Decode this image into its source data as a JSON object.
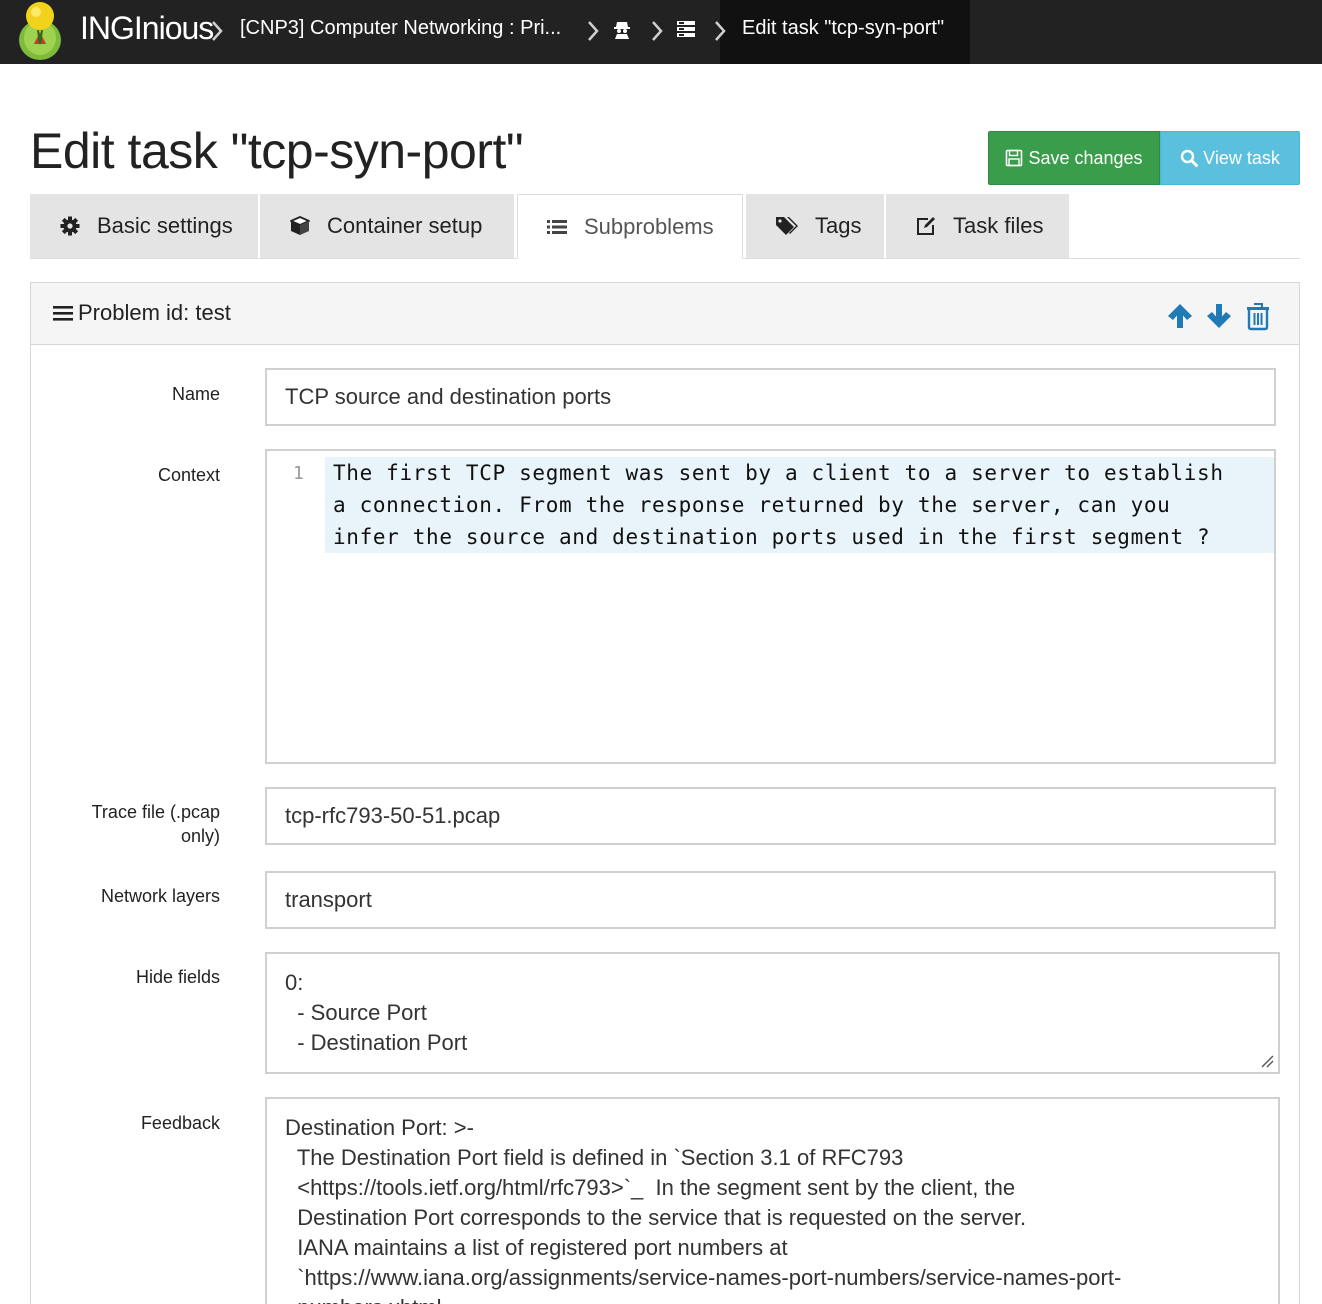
{
  "navbar": {
    "brand": "INGInious",
    "course": "[CNP3] Computer Networking : Pri...",
    "course_admin_icon": "user-secret-icon",
    "tasks_icon": "tasks-list-icon",
    "current": "Edit task \"tcp-syn-port\""
  },
  "header": {
    "title": "Edit task \"tcp-syn-port\"",
    "save_label": "Save changes",
    "view_label": "View task",
    "save_color": "#3a9d4b",
    "view_color": "#5bc0de"
  },
  "tabs": [
    {
      "label": "Basic settings",
      "icon": "gear-icon"
    },
    {
      "label": "Container setup",
      "icon": "cube-icon"
    },
    {
      "label": "Subproblems",
      "icon": "list-icon",
      "active": true
    },
    {
      "label": "Tags",
      "icon": "tags-icon"
    },
    {
      "label": "Task files",
      "icon": "edit-icon"
    }
  ],
  "problem": {
    "title": "Problem id: test",
    "name_label": "Name",
    "name_value": "TCP source and destination ports",
    "context_label": "Context",
    "context_line_number": "1",
    "context_lines": [
      "The first TCP segment was sent by a client to a server to establish",
      "a connection. From the response returned by the server, can you",
      "infer the source and destination ports used in the first segment ?"
    ],
    "trace_label_1": "Trace file (.pcap",
    "trace_label_2": "only)",
    "trace_value": "tcp-rfc793-50-51.pcap",
    "layers_label": "Network layers",
    "layers_value": "transport",
    "hide_label": "Hide fields",
    "hide_lines": [
      "0:",
      "  - Source Port",
      "  - Destination Port"
    ],
    "feedback_label": "Feedback",
    "feedback_lines": [
      "Destination Port: >-",
      "  The Destination Port field is defined in `Section 3.1 of RFC793",
      "  <https://tools.ietf.org/html/rfc793>`_  In the segment sent by the client, the",
      "  Destination Port corresponds to the service that is requested on the server.",
      "  IANA maintains a list of registered port numbers at",
      "  `https://www.iana.org/assignments/service-names-port-numbers/service-names-port-",
      "  numbers.xhtml"
    ]
  }
}
